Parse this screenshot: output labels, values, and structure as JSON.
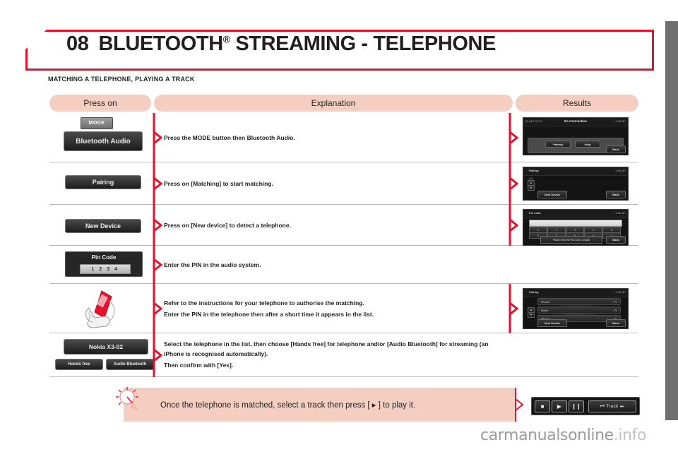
{
  "header": {
    "chapter_number": "08",
    "title": "BLUETOOTH",
    "title_sup": "®",
    "title_rest": " STREAMING - TELEPHONE",
    "subtitle": "MATCHING A TELEPHONE, PLAYING A TRACK",
    "accent_color": "#e8112d"
  },
  "table": {
    "headers": {
      "press_on": "Press on",
      "explanation": "Explanation",
      "results": "Results"
    },
    "header_bg": "#f4cec0",
    "rows": [
      {
        "id": "row-mode",
        "press_on": {
          "mode_button": "MODE",
          "bluetooth_audio_button": "Bluetooth Audio"
        },
        "explanation": [
          "Press the MODE button then Bluetooth Audio."
        ],
        "screen": {
          "source": "BLUETOOTH",
          "title": "No Connection",
          "clock": "1:35  18°",
          "buttons": [
            "Pairing",
            "Help"
          ],
          "back": "Back"
        }
      },
      {
        "id": "row-pairing",
        "press_on": {
          "pairing_button": "Pairing"
        },
        "explanation": [
          "Press on [Matching] to start matching."
        ],
        "screen": {
          "source": "",
          "title": "Pairing",
          "clock": "1:35  18°",
          "buttons": [
            "New Device"
          ],
          "back": "Back"
        }
      },
      {
        "id": "row-new-device",
        "press_on": {
          "new_device_button": "New Device"
        },
        "explanation": [
          "Press on [New device] to detect a telephone."
        ],
        "screen": {
          "source": "",
          "title": "Pin code",
          "clock": "1:35  18°",
          "keys": [
            "1",
            "2",
            "3",
            "4",
            "5",
            "6",
            "7",
            "8",
            "9",
            "0"
          ],
          "hint": "Please enter the Pin Code (4 Digits)",
          "back": "Back"
        }
      },
      {
        "id": "row-pin-code",
        "press_on": {
          "pin_code_label": "Pin Code",
          "pin_code_value": "1 2 3 4"
        },
        "explanation": [
          "Enter the PIN in the audio system."
        ],
        "screen": null
      },
      {
        "id": "row-authorise",
        "press_on": {
          "illustration": "hand-holding-phone-icon"
        },
        "explanation": [
          "Refer to the instructions for your telephone to authorise the matching.",
          "Enter the PIN in the telephone then after a short time it appears in the list."
        ],
        "screen": {
          "source": "",
          "title": "Pairing",
          "clock": "1:35  18°",
          "devices": [
            "iPhone",
            "Nokia",
            "iPhone"
          ],
          "buttons": [
            "New Device"
          ],
          "back": "Back"
        }
      },
      {
        "id": "row-select-telephone",
        "press_on": {
          "device_button": "Nokia  X3-02",
          "hands_free_button": "Hands free",
          "audio_bluetooth_button": "Audio Bluetooth"
        },
        "explanation": [
          "Select the telephone in the list, then choose [Hands free] for telephone and/or [Audio Bluetooth] for streaming (an iPhone is recognised automatically).",
          "Then confirm with [Yes]."
        ],
        "screen": null
      }
    ]
  },
  "note": {
    "icon": "lightbulb-icon",
    "text": "Once the telephone is matched, select a track then press [ ▸ ] to play it.",
    "bg": "#f4cec0"
  },
  "media_controls": {
    "stop": "■",
    "play": "▶",
    "pause": "❙❙",
    "track": "⏮ Track ⏭"
  },
  "watermark": {
    "main": "carmanualsonline",
    "suffix": ".info"
  }
}
